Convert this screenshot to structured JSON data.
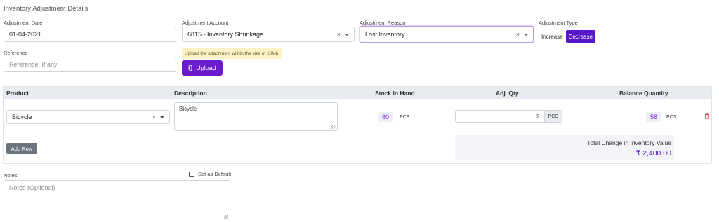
{
  "section_title": "Inventory Adjustment Details",
  "adjustment_date": {
    "label": "Adjustment Date",
    "value": "01-04-2021"
  },
  "adjustment_account": {
    "label": "Adjustment Account",
    "value": "6815 - Inventory Shrinkage",
    "clear": "×"
  },
  "adjustment_reason": {
    "label": "Adjustment Reason",
    "value": "Lost Inventory",
    "clear": "×"
  },
  "adjustment_type": {
    "label": "Adjustment Type",
    "options": [
      "Increase",
      "Decrease"
    ],
    "selected": "Decrease"
  },
  "reference": {
    "label": "Reference",
    "placeholder": "Reference, If any"
  },
  "upload": {
    "hint": "Upload the attachment within the size of 10Mb.",
    "button_label": "Upload"
  },
  "table": {
    "headers": {
      "product": "Product",
      "description": "Description",
      "stock_in_hand": "Stock in Hand",
      "adj_qty": "Adj. Qty",
      "balance_quantity": "Balance Quantity"
    },
    "rows": [
      {
        "product": "Bicycle",
        "description": "Bicycle",
        "stock_in_hand": "60",
        "stock_unit": "PCS",
        "adj_qty": "2",
        "adj_unit": "PCS",
        "balance": "58",
        "balance_unit": "PCS"
      }
    ],
    "add_row_label": "Add Row",
    "total_label": "Total Change in Inventory Value",
    "total_value": "₹ 2,400.00"
  },
  "notes": {
    "label": "Notes",
    "placeholder": "Notes (Optional)",
    "set_default_label": "Set as Default"
  },
  "colors": {
    "accent": "#5a16c9",
    "value_purple": "#7a2ad6",
    "hint_bg": "#fdf1c8",
    "delete_red": "#e0474c"
  }
}
